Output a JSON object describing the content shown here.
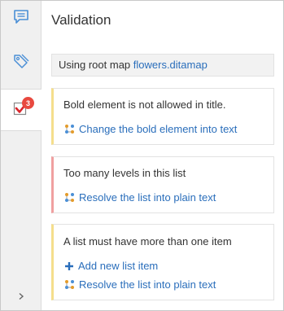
{
  "panel": {
    "title": "Validation"
  },
  "root_map": {
    "prefix": "Using root map ",
    "link": "flowers.ditamap"
  },
  "sidebar": {
    "badge_count": "3"
  },
  "results": [
    {
      "severity": "warning",
      "message": "Bold element is not allowed in title.",
      "actions": [
        {
          "icon": "quick-fix-icon",
          "label": "Change the bold element into text"
        }
      ]
    },
    {
      "severity": "error",
      "message": "Too many levels in this list",
      "actions": [
        {
          "icon": "quick-fix-icon",
          "label": "Resolve the list into plain text"
        }
      ]
    },
    {
      "severity": "warning",
      "message": "A list must have more than one item",
      "actions": [
        {
          "icon": "plus-icon",
          "label": "Add new list item"
        },
        {
          "icon": "quick-fix-icon",
          "label": "Resolve the list into plain text"
        }
      ]
    }
  ],
  "colors": {
    "link": "#2a6ebb",
    "warning_bar": "#f5de8c",
    "error_bar": "#f0a0a0",
    "badge": "#e8493f"
  }
}
